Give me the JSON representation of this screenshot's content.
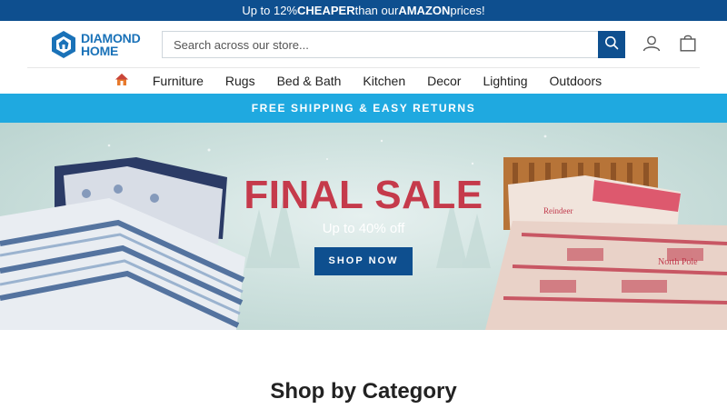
{
  "promo": {
    "text_1": "Up to 12% ",
    "strong_1": "CHEAPER",
    "text_2": " than our ",
    "strong_2": "AMAZON",
    "text_3": " prices!"
  },
  "brand": {
    "line1": "DIAMOND",
    "line2": "HOME"
  },
  "search": {
    "placeholder": "Search across our store..."
  },
  "nav": {
    "home_icon": "home-icon",
    "items": [
      "Furniture",
      "Rugs",
      "Bed & Bath",
      "Kitchen",
      "Decor",
      "Lighting",
      "Outdoors"
    ]
  },
  "shipping_bar": {
    "text": "FREE SHIPPING & EASY RETURNS"
  },
  "hero": {
    "title": "FINAL SALE",
    "subtitle": "Up to 40% off",
    "cta": "SHOP NOW",
    "pillow_text": "Reindeer",
    "duvet_text": "North Pole"
  },
  "sections": {
    "category_title": "Shop by Category"
  },
  "colors": {
    "brand_blue": "#0e4f8f",
    "accent_cyan": "#1fa9e0",
    "sale_red": "#c53a4b"
  }
}
